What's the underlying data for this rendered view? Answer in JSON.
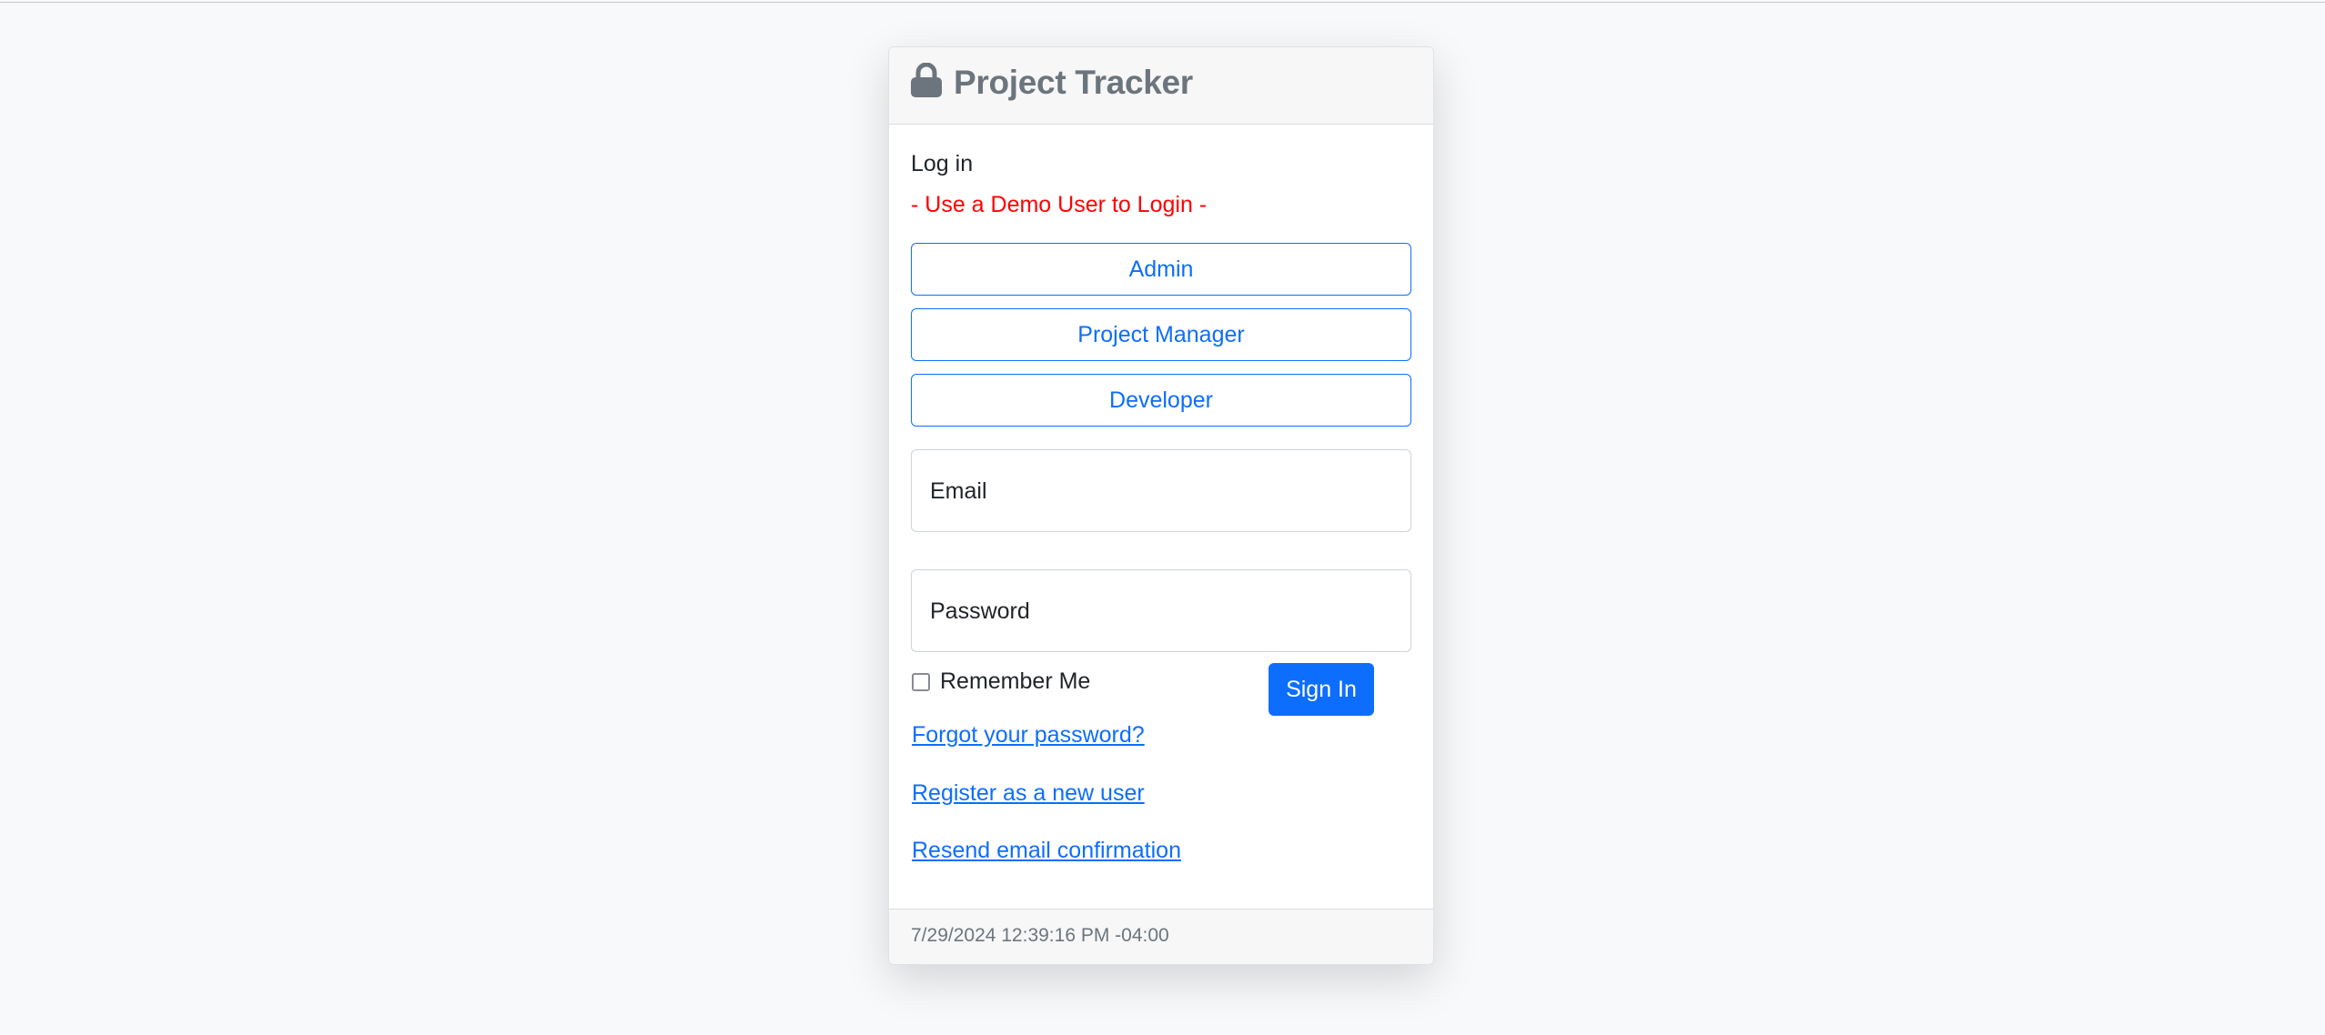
{
  "header": {
    "icon": "lock-icon",
    "title": "Project Tracker"
  },
  "login": {
    "heading": "Log in",
    "demo_prompt": "- Use a Demo User to Login -",
    "demo_users": [
      {
        "label": "Admin"
      },
      {
        "label": "Project Manager"
      },
      {
        "label": "Developer"
      }
    ],
    "email": {
      "label": "Email",
      "value": ""
    },
    "password": {
      "label": "Password",
      "value": ""
    },
    "remember_me": {
      "label": "Remember Me",
      "checked": false
    },
    "sign_in_label": "Sign In",
    "links": {
      "forgot_password": "Forgot your password?",
      "register": "Register as a new user",
      "resend_confirmation": "Resend email confirmation"
    }
  },
  "footer": {
    "timestamp": "7/29/2024 12:39:16 PM -04:00"
  },
  "colors": {
    "primary": "#0d6efd",
    "danger_text": "#ff0000",
    "muted": "#6c757d",
    "background": "#f8f9fa"
  }
}
